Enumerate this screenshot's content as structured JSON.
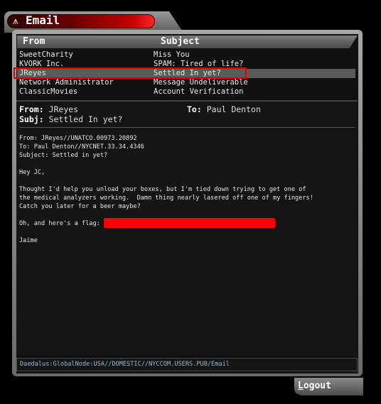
{
  "window": {
    "title": "Email",
    "icon": "satellite-dish-icon"
  },
  "columns": {
    "from": "From",
    "subject": "Subject"
  },
  "emails": [
    {
      "from": "SweetCharity",
      "subject": "Miss You",
      "selected": false
    },
    {
      "from": "KVORK Inc.",
      "subject": "SPAM: Tired of life?",
      "selected": false
    },
    {
      "from": "JReyes",
      "subject": "Settled In yet?",
      "selected": true
    },
    {
      "from": "Network Administrator",
      "subject": "Message Undeliverable",
      "selected": false
    },
    {
      "from": "ClassicMovies",
      "subject": "Account Verification",
      "selected": false
    }
  ],
  "message": {
    "from_label": "From:",
    "from_value": "JReyes",
    "to_label": "To:",
    "to_value": "Paul Denton",
    "subj_label": "Subj:",
    "subj_value": "Settled In yet?",
    "body_header": "From: JReyes//UNATCO.00973.20892\nTo: Paul Denton//NYCNET.33.34.4346\nSubject: Settled in yet?",
    "greeting": "Hey JC,",
    "paragraph": "Thought I'd help you unload your boxes, but I'm tied down trying to get one of\nthe medical analyzers working.  Damn thing nearly lasered off one of my fingers!\nCatch you later for a beer maybe?",
    "flag_line": "Oh, and here's a flag:",
    "signature": "Jaime"
  },
  "path": "Daedalus:GlobalNode:USA//DOMESTIC//NYCCOM.USERS.PUB/Email",
  "logout": {
    "accel": "L",
    "rest": "ogout"
  },
  "colors": {
    "accent_red": "#e00000",
    "flag_redaction": "#ff0000"
  }
}
